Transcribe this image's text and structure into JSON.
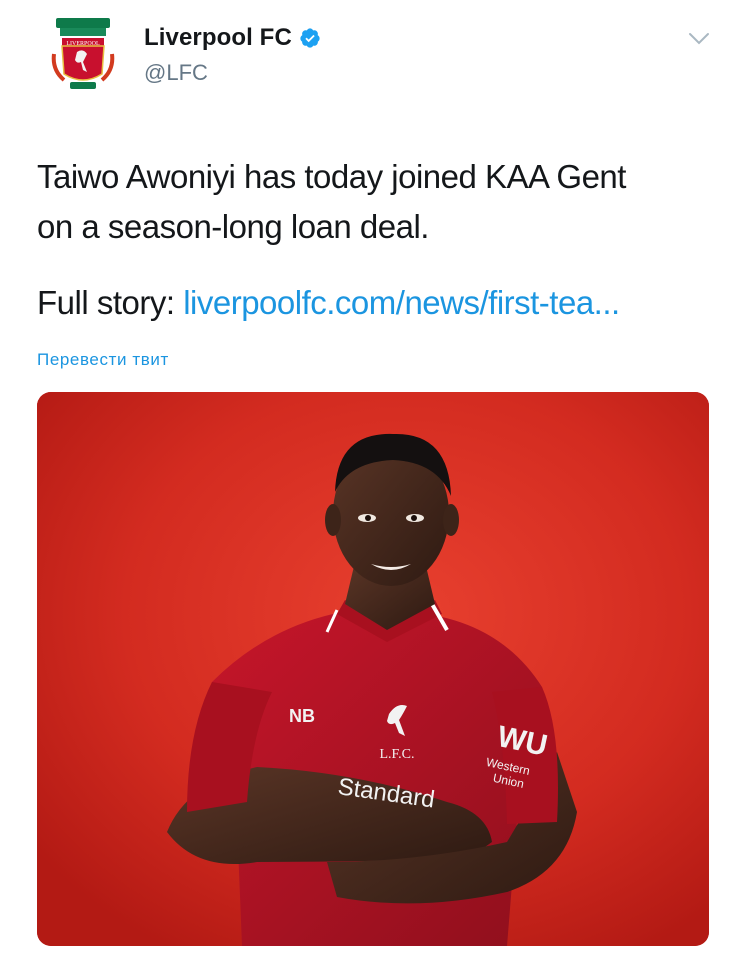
{
  "tweet": {
    "author": {
      "display_name": "Liverpool FC",
      "handle": "@LFC",
      "verified": true,
      "avatar_text": "LIVERPOOL",
      "avatar_icon": "lfc-crest-icon"
    },
    "text_line1": "Taiwo Awoniyi has today joined KAA Gent",
    "text_line2": "on a season-long loan deal.",
    "story_label": "Full story:",
    "story_link": "liverpoolfc.com/news/first-tea...",
    "translate_label": "Перевести твит",
    "menu_icon": "chevron-down-icon",
    "media": {
      "alt": "Player in red Liverpool shirt with arms crossed against red wall",
      "shirt_sponsor": "Standard Chartered",
      "shirt_crest": "L.F.C.",
      "sleeve_sponsor": "WU Western Union"
    }
  },
  "colors": {
    "link": "#1b95e0",
    "verified": "#1da1f2",
    "handle": "#657786",
    "text": "#14171a",
    "media_bg": "#d42a20"
  }
}
